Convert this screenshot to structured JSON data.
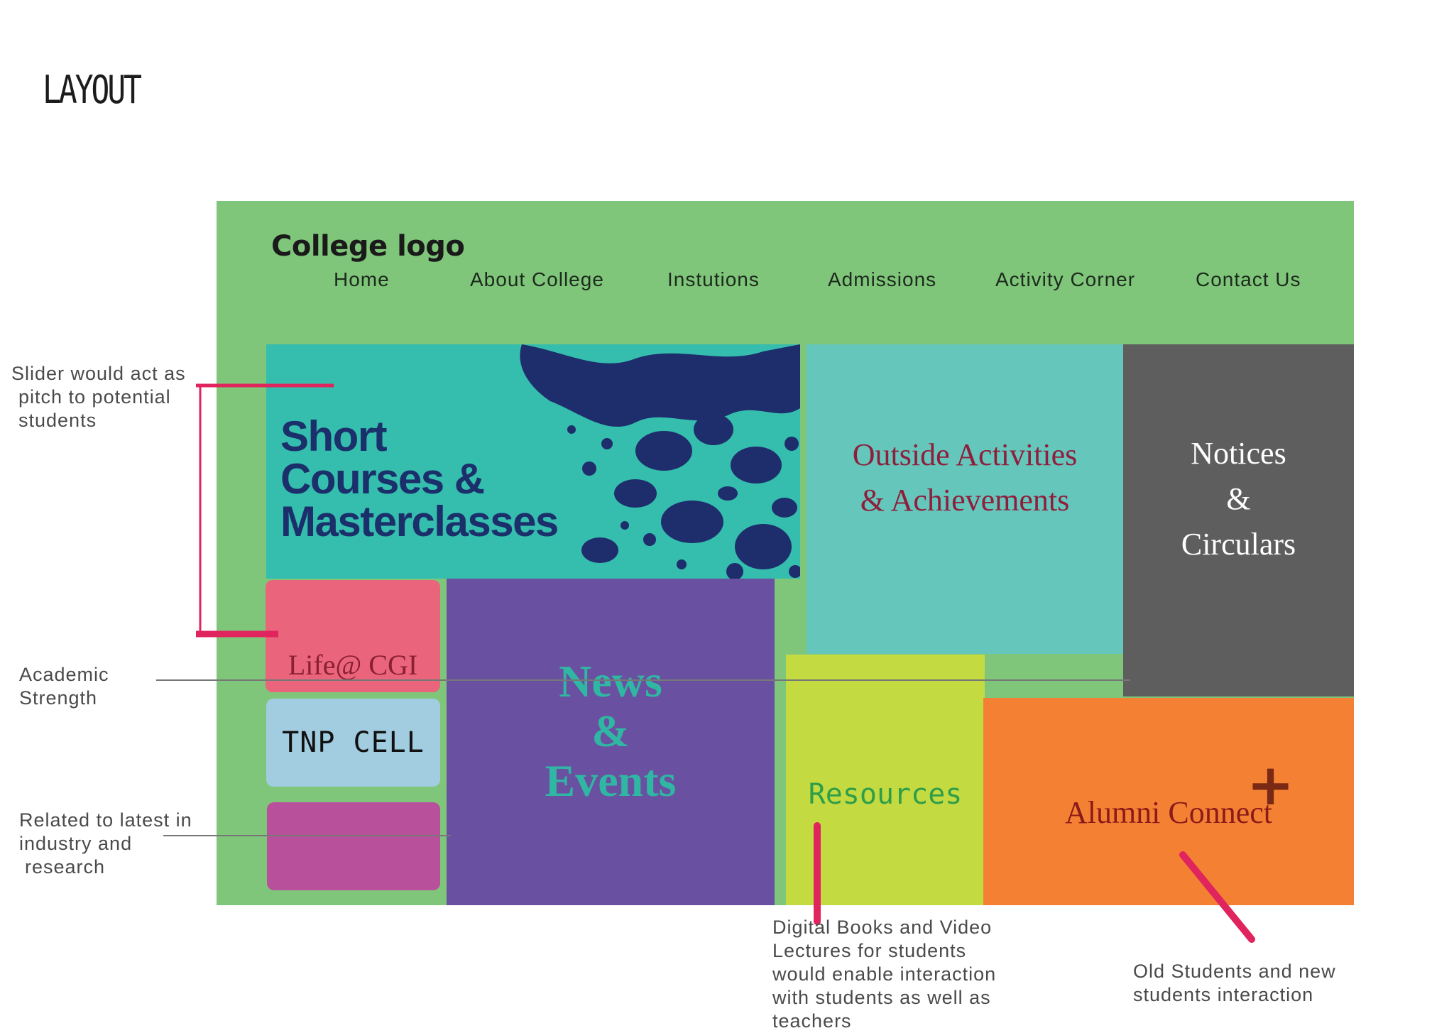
{
  "page_title": "LAYOUT",
  "mockup": {
    "logo": "College logo",
    "nav": [
      "Home",
      "About College",
      "Instutions",
      "Admissions",
      "Activity Corner",
      "Contact Us"
    ],
    "slider": {
      "lines": [
        "Short",
        "Courses &",
        "Masterclasses"
      ]
    },
    "outside": {
      "lines": [
        "Outside Activities",
        "& Achievements"
      ]
    },
    "notices": {
      "lines": [
        "Notices",
        "&",
        "Circulars"
      ]
    },
    "life": "Life@ CGI",
    "tnp": "TNP CELL",
    "news": {
      "lines": [
        "News",
        "&",
        "Events"
      ]
    },
    "resources": "Resources",
    "alumni": "Alumni Connect"
  },
  "annotations": {
    "slider": [
      "Slider would act as",
      "pitch to potential",
      "students"
    ],
    "academic": [
      "Academic",
      "Strength"
    ],
    "industry": [
      "Related to latest in",
      "industry and",
      "research"
    ],
    "digital": [
      "Digital Books and Video",
      "Lectures for students",
      "would enable interaction",
      "with students as well as",
      "teachers"
    ],
    "alumni": [
      "Old Students and new",
      "students interaction"
    ]
  },
  "colors": {
    "frame": "#7fc67a",
    "slider": "#35bdae",
    "outside": "#65c6bb",
    "notices": "#5e5e5e",
    "life": "#ea657b",
    "tnp": "#a2cce0",
    "pink_box": "#b8509c",
    "news": "#6950a0",
    "resources": "#c3da40",
    "alumni": "#f48133",
    "annotation_accent": "#e0245e"
  }
}
